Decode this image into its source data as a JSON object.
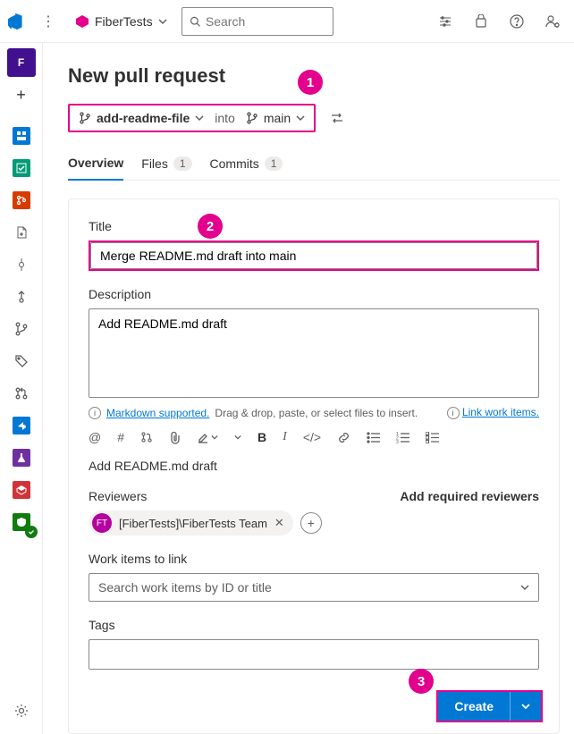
{
  "header": {
    "project_name": "FiberTests",
    "search_placeholder": "Search"
  },
  "page": {
    "title": "New pull request",
    "source_branch": "add-readme-file",
    "into_label": "into",
    "target_branch": "main"
  },
  "tabs": {
    "overview": "Overview",
    "files": "Files",
    "files_count": "1",
    "commits": "Commits",
    "commits_count": "1"
  },
  "form": {
    "title_label": "Title",
    "title_value": "Merge README.md draft into main",
    "desc_label": "Description",
    "desc_value": "Add README.md draft",
    "markdown_link": "Markdown supported.",
    "markdown_hint": "Drag & drop, paste, or select files to insert.",
    "link_work_items": "Link work items.",
    "preview_text": "Add README.md draft",
    "reviewers_label": "Reviewers",
    "add_required": "Add required reviewers",
    "reviewer_chip": "[FiberTests]\\FiberTests Team",
    "reviewer_initials": "FT",
    "work_items_label": "Work items to link",
    "work_items_placeholder": "Search work items by ID or title",
    "tags_label": "Tags"
  },
  "actions": {
    "create": "Create"
  },
  "callouts": {
    "one": "1",
    "two": "2",
    "three": "3"
  }
}
